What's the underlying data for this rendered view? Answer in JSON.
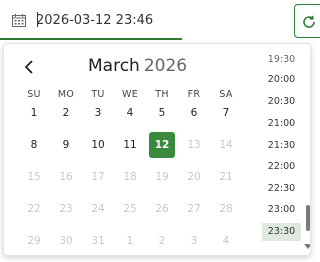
{
  "input": {
    "value": "2026-03-12 23:46"
  },
  "calendar": {
    "month": "March",
    "year": "2026",
    "weekdays": [
      "SU",
      "MO",
      "TU",
      "WE",
      "TH",
      "FR",
      "SA"
    ],
    "weeks": [
      [
        {
          "d": "1",
          "s": ""
        },
        {
          "d": "2",
          "s": ""
        },
        {
          "d": "3",
          "s": ""
        },
        {
          "d": "4",
          "s": ""
        },
        {
          "d": "5",
          "s": ""
        },
        {
          "d": "6",
          "s": ""
        },
        {
          "d": "7",
          "s": ""
        }
      ],
      [
        {
          "d": "8",
          "s": ""
        },
        {
          "d": "9",
          "s": ""
        },
        {
          "d": "10",
          "s": ""
        },
        {
          "d": "11",
          "s": ""
        },
        {
          "d": "12",
          "s": "selected"
        },
        {
          "d": "13",
          "s": "disabled"
        },
        {
          "d": "14",
          "s": "disabled"
        }
      ],
      [
        {
          "d": "15",
          "s": "disabled"
        },
        {
          "d": "16",
          "s": "disabled"
        },
        {
          "d": "17",
          "s": "disabled"
        },
        {
          "d": "18",
          "s": "disabled"
        },
        {
          "d": "19",
          "s": "disabled"
        },
        {
          "d": "20",
          "s": "disabled"
        },
        {
          "d": "21",
          "s": "disabled"
        }
      ],
      [
        {
          "d": "22",
          "s": "disabled"
        },
        {
          "d": "23",
          "s": "disabled"
        },
        {
          "d": "24",
          "s": "disabled"
        },
        {
          "d": "25",
          "s": "disabled"
        },
        {
          "d": "26",
          "s": "disabled"
        },
        {
          "d": "27",
          "s": "disabled"
        },
        {
          "d": "28",
          "s": "disabled"
        }
      ],
      [
        {
          "d": "29",
          "s": "disabled"
        },
        {
          "d": "30",
          "s": "disabled"
        },
        {
          "d": "31",
          "s": "disabled"
        },
        {
          "d": "1",
          "s": "disabled"
        },
        {
          "d": "2",
          "s": "disabled"
        },
        {
          "d": "3",
          "s": "disabled"
        },
        {
          "d": "4",
          "s": "disabled"
        }
      ]
    ]
  },
  "times": [
    "19:30",
    "20:00",
    "20:30",
    "21:00",
    "21:30",
    "22:00",
    "22:30",
    "23:00",
    "23:30"
  ],
  "selected_time": "23:30",
  "colors": {
    "accent": "#3a8a3e",
    "accent_border": "#2e7d32",
    "selected_time_bg": "#dfe9df",
    "disabled_text": "#c8c8c8"
  },
  "icons": {
    "input": "calendar-icon",
    "button": "refresh-icon",
    "prev": "chevron-left-icon"
  }
}
